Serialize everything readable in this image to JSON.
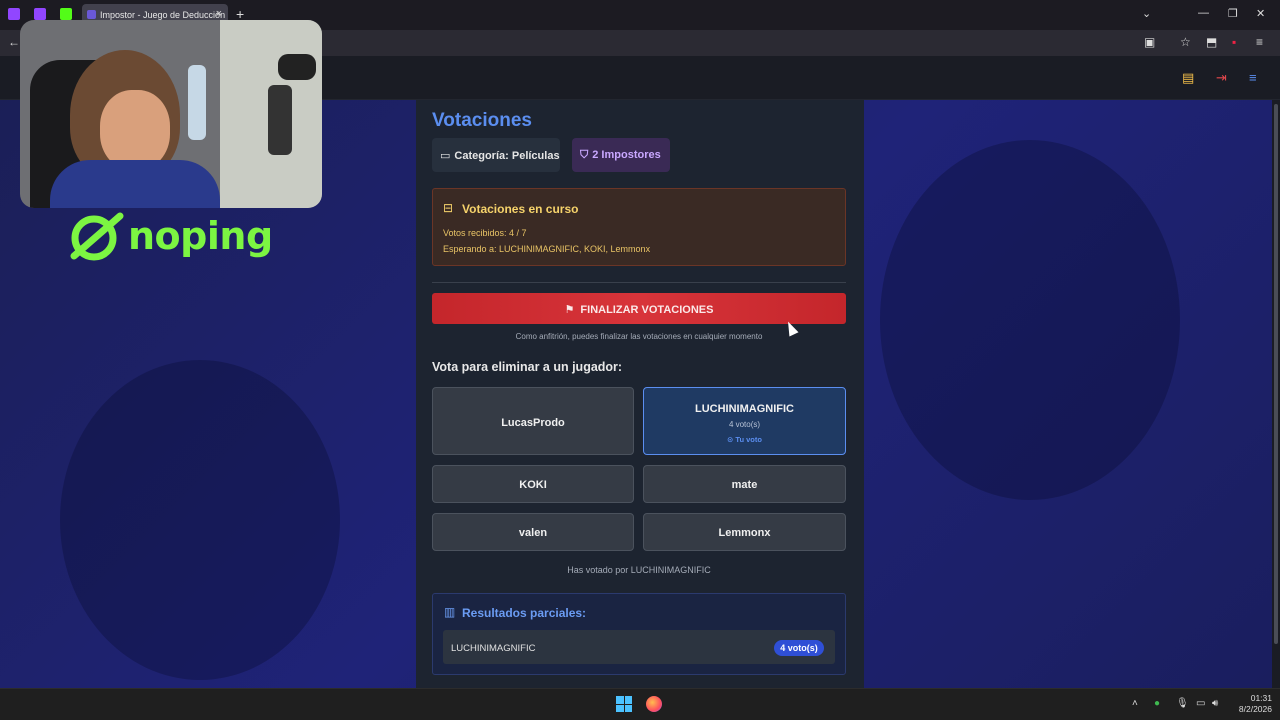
{
  "browser": {
    "active_tab_title": "Impostor - Juego de Deducción",
    "tab_close": "×",
    "new_tab": "+",
    "window_controls": {
      "dropdown": "⌄",
      "minimize": "—",
      "restore": "❐",
      "close": "✕"
    }
  },
  "page": {
    "title": "Votaciones",
    "category_chip": "Categoría: Películas",
    "impostors_chip": "2 Impostores",
    "status": {
      "title": "Votaciones en curso",
      "votes_received": "Votos recibidos: 4 / 7",
      "waiting_for": "Esperando a: LUCHINIMAGNIFIC, KOKI, Lemmonx"
    },
    "finalize_button": "FINALIZAR VOTACIONES",
    "host_note": "Como anfitrión, puedes finalizar las votaciones en cualquier momento",
    "vote_heading": "Vota para eliminar a un jugador:",
    "players": [
      {
        "name": "LucasProdo"
      },
      {
        "name": "LUCHINIMAGNIFIC",
        "votes": "4 voto(s)",
        "my_vote": "⊙ Tu voto"
      },
      {
        "name": "KOKI"
      },
      {
        "name": "mate"
      },
      {
        "name": "valen"
      },
      {
        "name": "Lemmonx"
      }
    ],
    "voted_note": "Has votado por LUCHINIMAGNIFIC",
    "results": {
      "title": "Resultados parciales:",
      "rows": [
        {
          "name": "LUCHINIMAGNIFIC",
          "badge": "4 voto(s)"
        }
      ]
    }
  },
  "overlay": {
    "logo_text": "noping"
  },
  "taskbar": {
    "time": "01:31",
    "date": "8/2/2026"
  },
  "colors": {
    "accent_blue": "#5b8ef0",
    "finalize_red": "#d8343a",
    "status_yellow": "#f6d36b",
    "logo_green": "#7cf542"
  }
}
